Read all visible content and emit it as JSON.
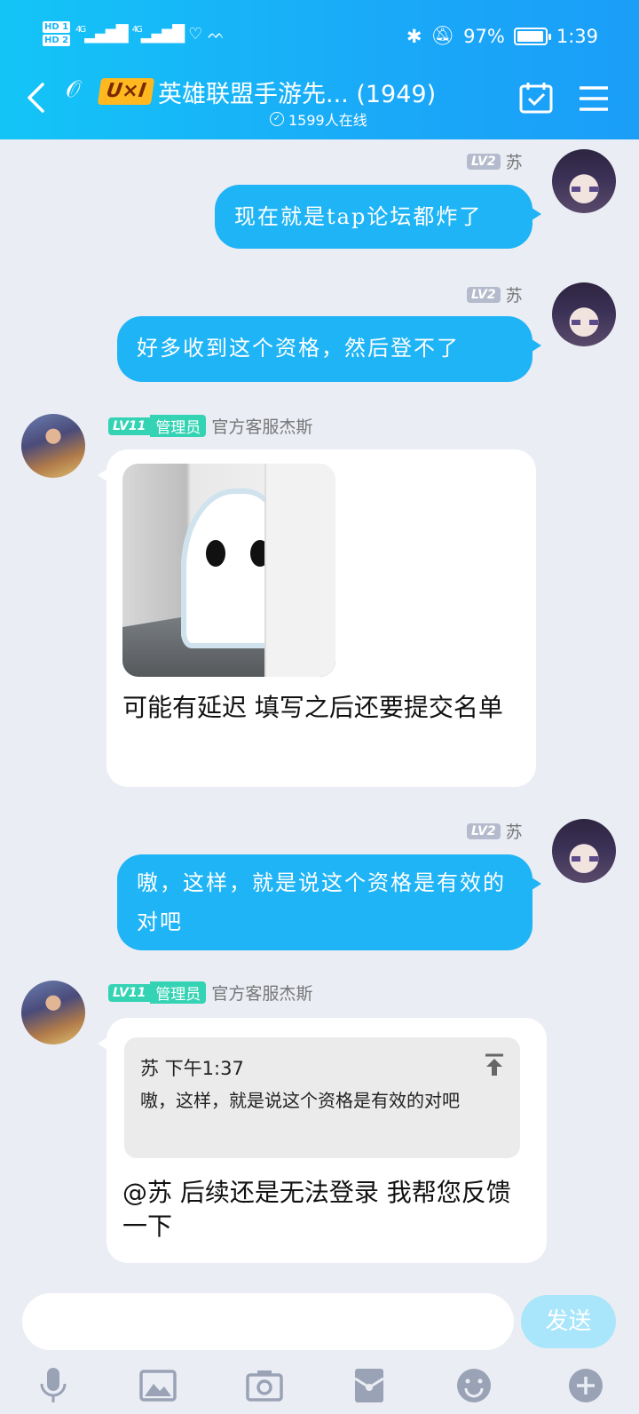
{
  "status_bar": {
    "hd1": "HD 1",
    "hd2": "HD 2",
    "signal1": "4G",
    "signal2": "4G",
    "battery_percent": "97%",
    "battery_level": 0.97,
    "time": "1:39"
  },
  "header": {
    "logo_text": "U×I",
    "title": "英雄联盟手游先... (1949)",
    "online": "1599人在线"
  },
  "messages": [
    {
      "sender": "苏",
      "level": "LV2",
      "text": "现在就是tap论坛都炸了"
    },
    {
      "sender": "苏",
      "level": "LV2",
      "text": "好多收到这个资格，然后登不了"
    },
    {
      "sender": "官方客服杰斯",
      "level": "LV11",
      "role": "管理员",
      "text": "可能有延迟  填写之后还要提交名单"
    },
    {
      "sender": "苏",
      "level": "LV2",
      "text": "嗷，这样，就是说这个资格是有效的对吧"
    },
    {
      "sender": "官方客服杰斯",
      "level": "LV11",
      "role": "管理员",
      "quote": {
        "author_time": "苏 下午1:37",
        "text": "嗷，这样，就是说这个资格是有效的对吧"
      },
      "text": "@苏 后续还是无法登录 我帮您反馈一下"
    }
  ],
  "input": {
    "send_label": "发送"
  },
  "toolbar_icons": [
    "microphone-icon",
    "image-icon",
    "camera-icon",
    "red-packet-icon",
    "emoji-icon",
    "plus-icon"
  ],
  "colors": {
    "header": "#1aa9f8",
    "my_bubble": "#1fb4f6",
    "admin_badge": "#33d3b4",
    "background": "#ebedf5"
  }
}
